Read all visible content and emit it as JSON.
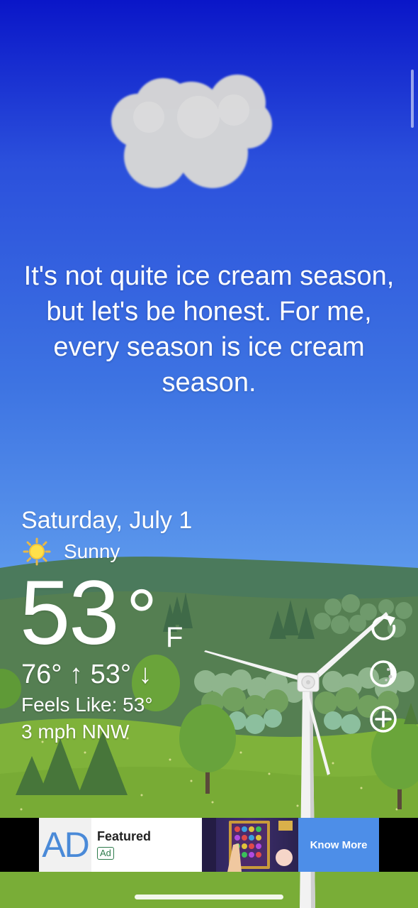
{
  "quote": "It's not quite ice cream season, but let's be honest. For me, every season is ice cream season.",
  "weather": {
    "date": "Saturday, July 1",
    "condition": "Sunny",
    "condition_icon": "sun-icon",
    "temperature": "53",
    "degree_symbol": "°",
    "unit": "F",
    "high_low": "76° ↑  53° ↓",
    "feels_like": "Feels Like: 53°",
    "wind": "3 mph NNW"
  },
  "actions": [
    {
      "icon": "refresh-icon"
    },
    {
      "icon": "theme-icon"
    },
    {
      "icon": "add-icon"
    }
  ],
  "ad": {
    "logo_text": "AD",
    "title": "Featured",
    "tag": "Ad",
    "cta": "Know More"
  },
  "colors": {
    "sky_top": "#0a16c8",
    "sky_bottom": "#8fc2f4",
    "grass": "#7fb23a",
    "ad_cta": "#4d8ee8"
  }
}
